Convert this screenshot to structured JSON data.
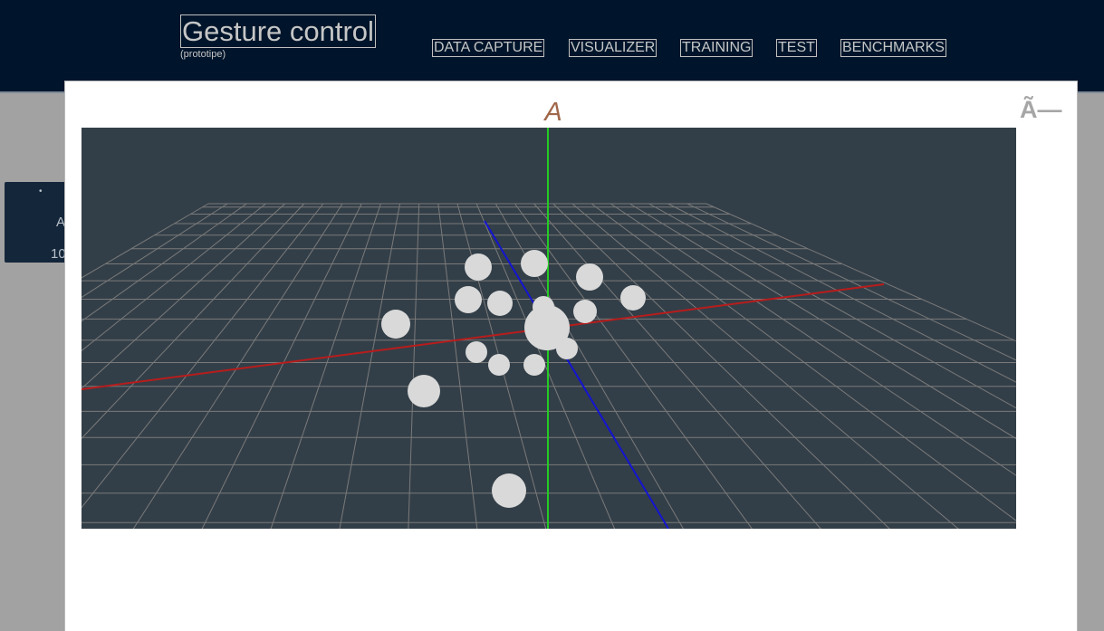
{
  "app": {
    "title": "Gesture control",
    "subtitle": "(prototipe)"
  },
  "nav": {
    "items": [
      {
        "label": "DATA CAPTURE",
        "name": "nav-data-capture"
      },
      {
        "label": "VISUALIZER",
        "name": "nav-visualizer"
      },
      {
        "label": "TRAINING",
        "name": "nav-training"
      },
      {
        "label": "TEST",
        "name": "nav-test"
      },
      {
        "label": "BENCHMARKS",
        "name": "nav-benchmarks"
      }
    ]
  },
  "side_card": {
    "bullet": "•",
    "text1": "A",
    "text2": "10"
  },
  "modal": {
    "title": "A",
    "close_label": "Ã—"
  },
  "viewport": {
    "background": "#333f48",
    "grid_color": "#7a7a7a",
    "axis_x_color": "#b81c1c",
    "axis_y_color": "#22cc22",
    "axis_z_color": "#1414d0",
    "point_color": "#d9d9d9"
  },
  "colors": {
    "header_bg": "#00152b",
    "page_bg": "#a2a2a2",
    "title_accent": "#a0674a"
  }
}
